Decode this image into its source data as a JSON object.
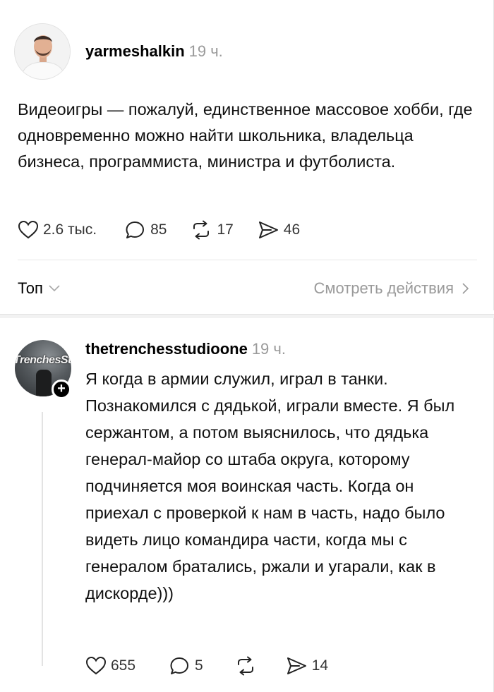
{
  "post": {
    "author": "yarmeshalkin",
    "time": "19 ч.",
    "text": "Видеоигры — пожалуй, единственное массовое хобби, где одновременно можно найти школьника, владельца бизнеса, программиста, министра и футболиста.",
    "likes": "2.6 тыс.",
    "comments": "85",
    "reposts": "17",
    "shares": "46"
  },
  "filter": {
    "sort_label": "Топ",
    "view_activity": "Смотреть действия"
  },
  "reply": {
    "author": "thetrenchesstudioone",
    "time": "19 ч.",
    "avatar_text": "TrenchesSt",
    "text": "Я когда в армии служил, играл в танки. Познакомился с дядькой, играли вместе. Я был сержантом, а потом выяснилось, что дядька генерал-майор со штаба округа, которому подчиняется моя воинская часть. Когда он приехал с проверкой к нам в часть, надо было видеть лицо командира части, когда мы с генералом братались, ржали и угарали, как в дискорде)))",
    "likes": "655",
    "comments": "5",
    "shares": "14"
  },
  "icons": {
    "like": "heart-icon",
    "comment": "comment-bubble-icon",
    "repost": "repost-icon",
    "share": "send-icon",
    "sort_chevron": "chevron-down-icon",
    "activity_chevron": "chevron-right-icon",
    "follow": "plus-icon"
  }
}
